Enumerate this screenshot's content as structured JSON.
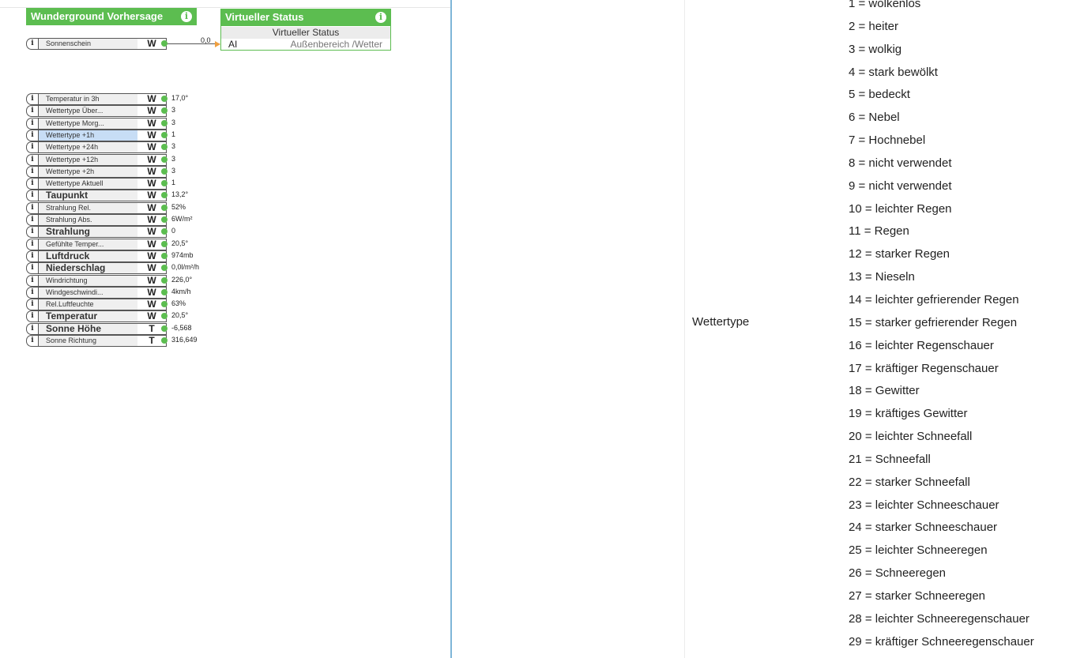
{
  "wunderground_block": {
    "title": "Wunderground Vorhersage"
  },
  "status_block": {
    "title": "Virtueller Status",
    "subtitle": "Virtueller Status",
    "input_label": "AI",
    "input_value": "Außenbereich /Wetter"
  },
  "connection": {
    "value": "0,0"
  },
  "sonnenschein": {
    "label": "Sonnenschein",
    "type": "W"
  },
  "outputs": [
    {
      "label": "Temperatur in 3h",
      "type": "W",
      "value": "17,0°"
    },
    {
      "label": "Wettertype Über...",
      "type": "W",
      "value": "3"
    },
    {
      "label": "Wettertype Morg...",
      "type": "W",
      "value": "3"
    },
    {
      "label": "Wettertype +1h",
      "type": "W",
      "value": "1"
    },
    {
      "label": "Wettertype +24h",
      "type": "W",
      "value": "3"
    },
    {
      "label": "Wettertype +12h",
      "type": "W",
      "value": "3"
    },
    {
      "label": "Wettertype +2h",
      "type": "W",
      "value": "3"
    },
    {
      "label": "Wettertype Aktuell",
      "type": "W",
      "value": "1"
    },
    {
      "label": "Taupunkt",
      "type": "W",
      "value": "13,2°"
    },
    {
      "label": "Strahlung Rel.",
      "type": "W",
      "value": "52%"
    },
    {
      "label": "Strahlung Abs.",
      "type": "W",
      "value": "6W/m²"
    },
    {
      "label": "Strahlung",
      "type": "W",
      "value": "0"
    },
    {
      "label": "Gefühlte Temper...",
      "type": "W",
      "value": "20,5°"
    },
    {
      "label": "Luftdruck",
      "type": "W",
      "value": "974mb"
    },
    {
      "label": "Niederschlag",
      "type": "W",
      "value": "0,0l/m²/h"
    },
    {
      "label": "Windrichtung",
      "type": "W",
      "value": "226,0°"
    },
    {
      "label": "Windgeschwindi...",
      "type": "W",
      "value": "4km/h"
    },
    {
      "label": "Rel.Luftfeuchte",
      "type": "W",
      "value": "63%"
    },
    {
      "label": "Temperatur",
      "type": "W",
      "value": "20,5°"
    },
    {
      "label": "Sonne Höhe",
      "type": "T",
      "value": "-6,568"
    },
    {
      "label": "Sonne Richtung",
      "type": "T",
      "value": "316,649"
    }
  ],
  "help": {
    "param_name": "Wettertype",
    "codes": [
      "1 = wolkenlos",
      "2 = heiter",
      "3 = wolkig",
      "4 = stark bewölkt",
      "5 = bedeckt",
      "6 = Nebel",
      "7 = Hochnebel",
      "8 = nicht verwendet",
      "9 = nicht verwendet",
      "10 = leichter Regen",
      "11 = Regen",
      "12 = starker Regen",
      "13 = Nieseln",
      "14 = leichter gefrierender Regen",
      "15 = starker gefrierender Regen",
      "16 = leichter Regenschauer",
      "17 = kräftiger Regenschauer",
      "18 = Gewitter",
      "19 = kräftiges Gewitter",
      "20 = leichter Schneefall",
      "21 = Schneefall",
      "22 = starker Schneefall",
      "23 = leichter Schneeschauer",
      "24 = starker Schneeschauer",
      "25 = leichter Schneeregen",
      "26 = Schneeregen",
      "27 = starker Schneeregen",
      "28 = leichter Schneeregenschauer",
      "29 = kräftiger Schneeregenschauer"
    ]
  }
}
